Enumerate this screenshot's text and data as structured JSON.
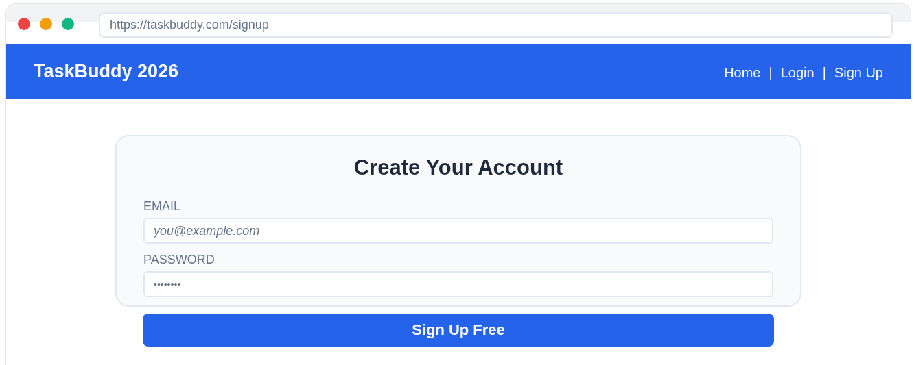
{
  "browser": {
    "url": "https://taskbuddy.com/signup"
  },
  "header": {
    "title": "TaskBuddy 2026",
    "nav": [
      {
        "kind": "link",
        "label": "Home"
      },
      {
        "kind": "separator",
        "label": "|"
      },
      {
        "kind": "link",
        "label": "Login"
      },
      {
        "kind": "separator",
        "label": "|"
      },
      {
        "kind": "link",
        "label": "Sign Up"
      }
    ]
  },
  "form": {
    "title": "Create Your Account",
    "fields": [
      {
        "label": "EMAIL",
        "placeholder": "you@example.com",
        "kind": "email"
      },
      {
        "label": "PASSWORD",
        "value": "••••••••",
        "kind": "password"
      }
    ],
    "submit": "Sign Up Free"
  }
}
